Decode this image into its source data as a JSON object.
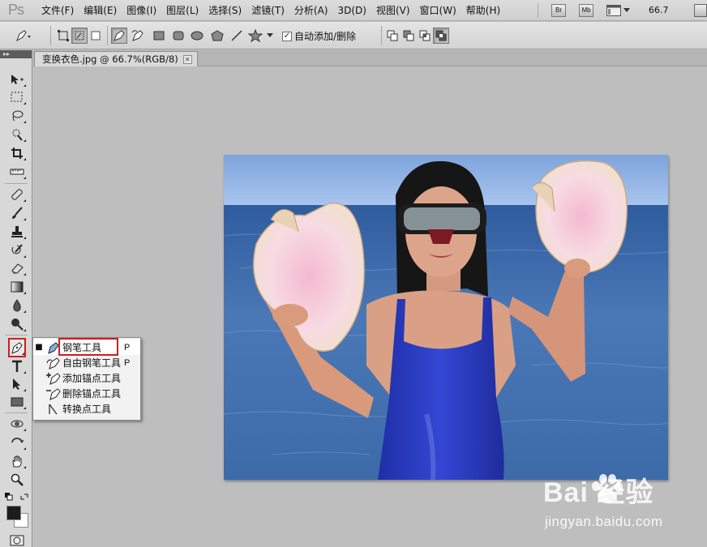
{
  "app": {
    "logo": "Ps"
  },
  "menu": [
    "文件(F)",
    "编辑(E)",
    "图像(I)",
    "图层(L)",
    "选择(S)",
    "滤镜(T)",
    "分析(A)",
    "3D(D)",
    "视图(V)",
    "窗口(W)",
    "帮助(H)"
  ],
  "menubar_right": {
    "bridge": "Br",
    "minibridge": "Mb",
    "zoom": "66.7"
  },
  "options": {
    "auto_add_delete": "自动添加/删除",
    "auto_add_checked": "✓"
  },
  "document": {
    "tab_title": "变换衣色.jpg @ 66.7%(RGB/8)",
    "close_glyph": "✕"
  },
  "toolbar": {
    "collapse_glyph": "▸▸"
  },
  "flyout": {
    "items": [
      {
        "label": "钢笔工具",
        "key": "P",
        "icon": "pen-icon",
        "selected": true
      },
      {
        "label": "自由钢笔工具",
        "key": "P",
        "icon": "freeform-pen-icon",
        "selected": false
      },
      {
        "label": "添加锚点工具",
        "key": "",
        "icon": "add-anchor-icon",
        "selected": false
      },
      {
        "label": "删除锚点工具",
        "key": "",
        "icon": "delete-anchor-icon",
        "selected": false
      },
      {
        "label": "转换点工具",
        "key": "",
        "icon": "convert-point-icon",
        "selected": false
      }
    ],
    "selected_marker": "■"
  },
  "watermark": {
    "brand": "Bai  经验",
    "url": "jingyan.baidu.com"
  },
  "colors": {
    "highlight": "#d21c1c",
    "swimsuit": "#2a3dc8",
    "sea": "#3a67a8",
    "sky": "#8fb4e8"
  }
}
